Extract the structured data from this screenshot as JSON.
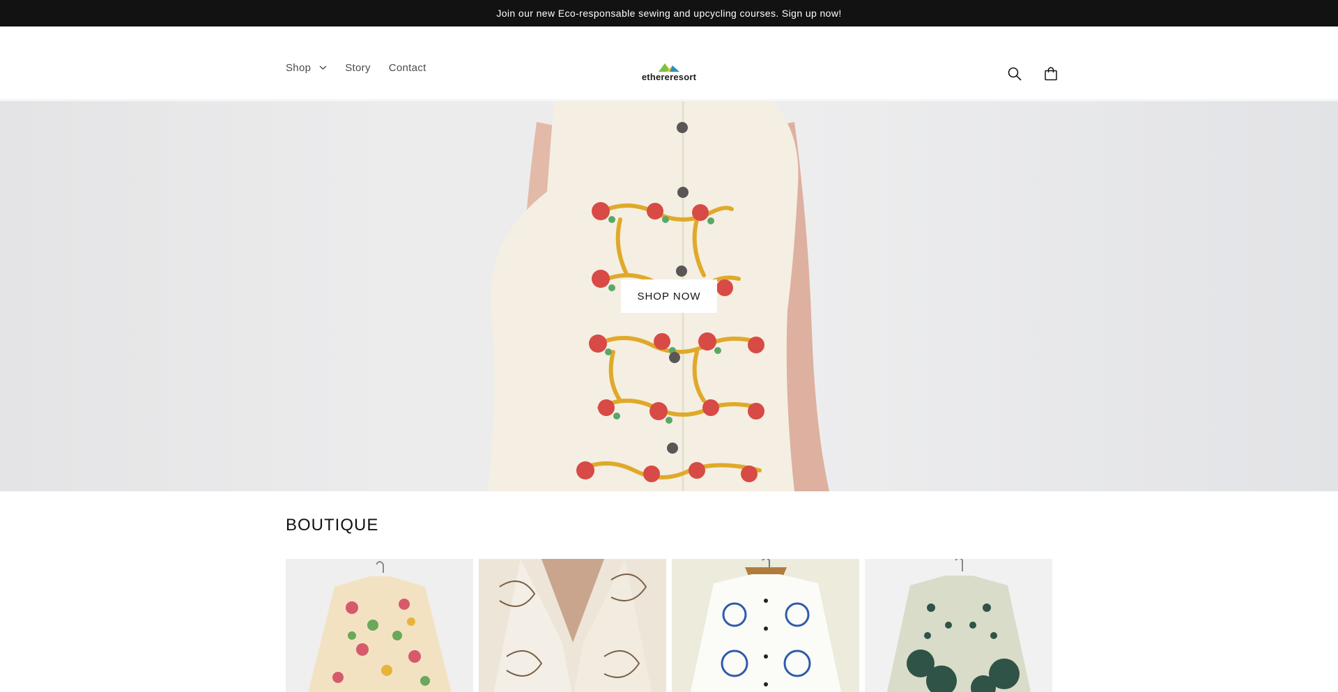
{
  "announcement": {
    "text": "Join our new Eco-responsable sewing and upcycling courses. Sign up now!"
  },
  "header": {
    "nav": [
      {
        "label": "Shop",
        "has_dropdown": true
      },
      {
        "label": "Story"
      },
      {
        "label": "Contact"
      }
    ],
    "logo_text": "ethereresort",
    "icons": [
      "search-icon",
      "cart-icon"
    ]
  },
  "hero": {
    "button_label": "SHOP NOW"
  },
  "boutique": {
    "title": "BOUTIQUE",
    "products": [
      {
        "name": "floral-embroidered-jacket"
      },
      {
        "name": "cream-floral-blazer"
      },
      {
        "name": "blue-embroidered-jacket"
      },
      {
        "name": "green-pattern-jacket"
      }
    ]
  },
  "colors": {
    "announcement_bg": "#121212",
    "text": "#121212",
    "nav_text": "#4a4a4a"
  }
}
